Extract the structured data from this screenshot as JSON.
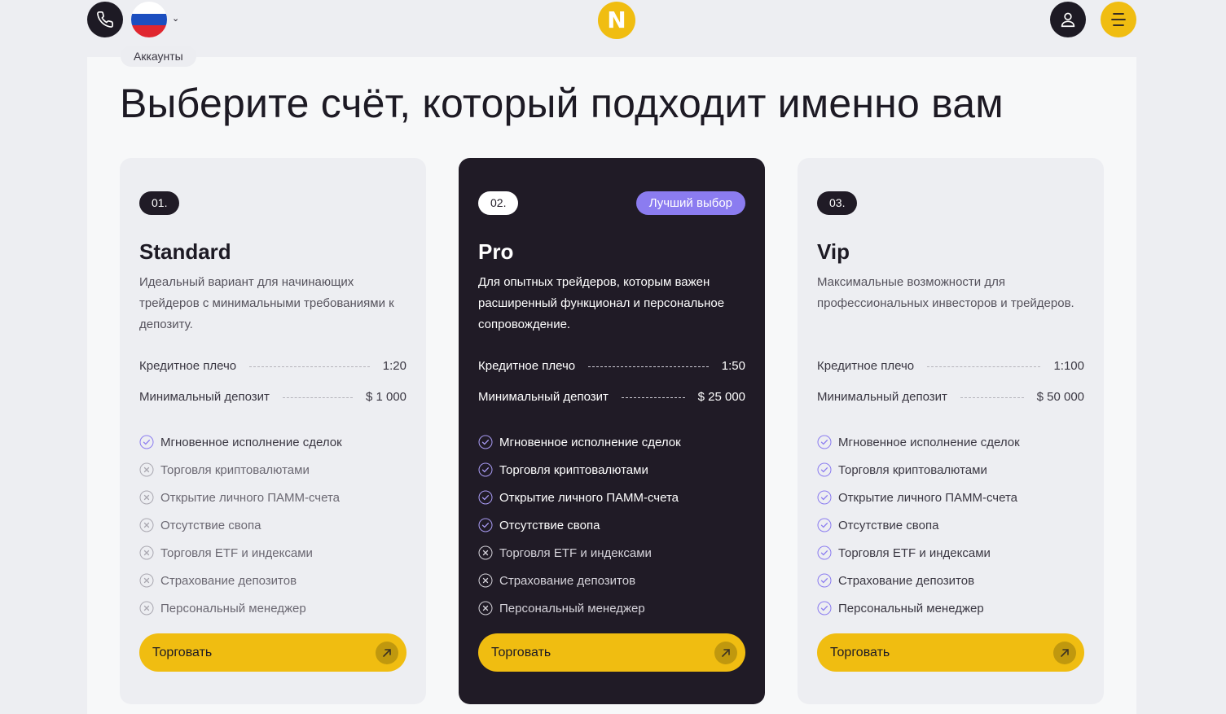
{
  "header": {
    "phone_icon": "phone-icon",
    "language_flag": "russia-flag",
    "logo_letter": "N",
    "user_icon": "user-icon",
    "menu_icon": "menu-icon"
  },
  "colors": {
    "accent": "#f0bd11",
    "dark": "#201b26",
    "badge": "#8b7cf0",
    "check": "#8b7cf0"
  },
  "breadcrumb": "Аккаунты",
  "title": "Выберите счёт, который подходит именно вам",
  "cards": [
    {
      "num": "01.",
      "name": "Standard",
      "desc": "Идеальный вариант для начинающих трейдеров с минимальными требованиями к депозиту.",
      "leverage_label": "Кредитное плечо",
      "leverage": "1:20",
      "deposit_label": "Минимальный депозит",
      "deposit": "$ 1 000",
      "features": [
        {
          "label": "Мгновенное исполнение сделок",
          "on": true
        },
        {
          "label": "Торговля криптовалютами",
          "on": false
        },
        {
          "label": "Открытие личного ПАММ-счета",
          "on": false
        },
        {
          "label": "Отсутствие свопа",
          "on": false
        },
        {
          "label": "Торговля ETF и индексами",
          "on": false
        },
        {
          "label": "Страхование депозитов",
          "on": false
        },
        {
          "label": "Персональный менеджер",
          "on": false
        }
      ],
      "button": "Торговать"
    },
    {
      "num": "02.",
      "badge": "Лучший выбор",
      "name": "Pro",
      "desc": "Для опытных трейдеров, которым важен расширенный функционал и персональное сопровождение.",
      "leverage_label": "Кредитное плечо",
      "leverage": "1:50",
      "deposit_label": "Минимальный депозит",
      "deposit": "$ 25 000",
      "features": [
        {
          "label": "Мгновенное исполнение сделок",
          "on": true
        },
        {
          "label": "Торговля криптовалютами",
          "on": true
        },
        {
          "label": "Открытие личного ПАММ-счета",
          "on": true
        },
        {
          "label": "Отсутствие свопа",
          "on": true
        },
        {
          "label": "Торговля ETF и индексами",
          "on": false
        },
        {
          "label": "Страхование депозитов",
          "on": false
        },
        {
          "label": "Персональный менеджер",
          "on": false
        }
      ],
      "button": "Торговать"
    },
    {
      "num": "03.",
      "name": "Vip",
      "desc": "Максимальные возможности для профессиональных инвесторов и трейдеров.",
      "leverage_label": "Кредитное плечо",
      "leverage": "1:100",
      "deposit_label": "Минимальный депозит",
      "deposit": "$ 50 000",
      "features": [
        {
          "label": "Мгновенное исполнение сделок",
          "on": true
        },
        {
          "label": "Торговля криптовалютами",
          "on": true
        },
        {
          "label": "Открытие личного ПАММ-счета",
          "on": true
        },
        {
          "label": "Отсутствие свопа",
          "on": true
        },
        {
          "label": "Торговля ETF и индексами",
          "on": true
        },
        {
          "label": "Страхование депозитов",
          "on": true
        },
        {
          "label": "Персональный менеджер",
          "on": true
        }
      ],
      "button": "Торговать"
    }
  ]
}
